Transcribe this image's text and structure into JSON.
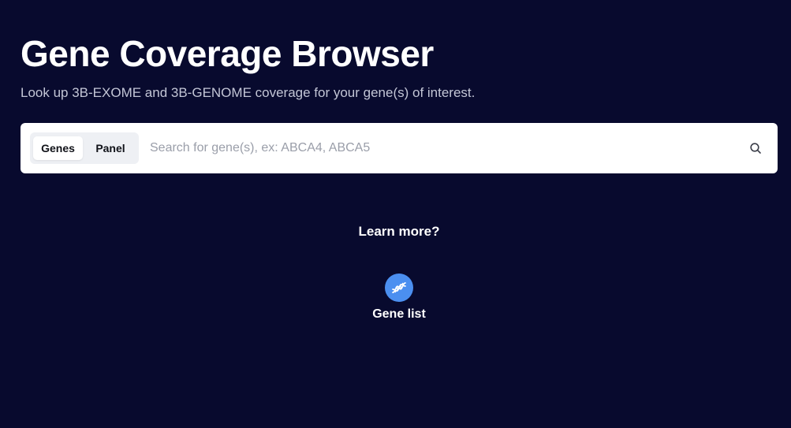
{
  "header": {
    "title": "Gene Coverage Browser",
    "subtitle": "Look up 3B-EXOME and 3B-GENOME coverage for your gene(s) of interest."
  },
  "search": {
    "modes": [
      {
        "label": "Genes",
        "active": true
      },
      {
        "label": "Panel",
        "active": false
      }
    ],
    "value": "",
    "placeholder": "Search for gene(s), ex: ABCA4, ABCA5",
    "icon": "search-icon"
  },
  "learn_more": {
    "heading": "Learn more?",
    "links": [
      {
        "label": "Gene list",
        "icon": "dna-icon"
      }
    ]
  },
  "colors": {
    "background": "#080a2e",
    "accent": "#4b8ff0",
    "card": "#ffffff"
  }
}
